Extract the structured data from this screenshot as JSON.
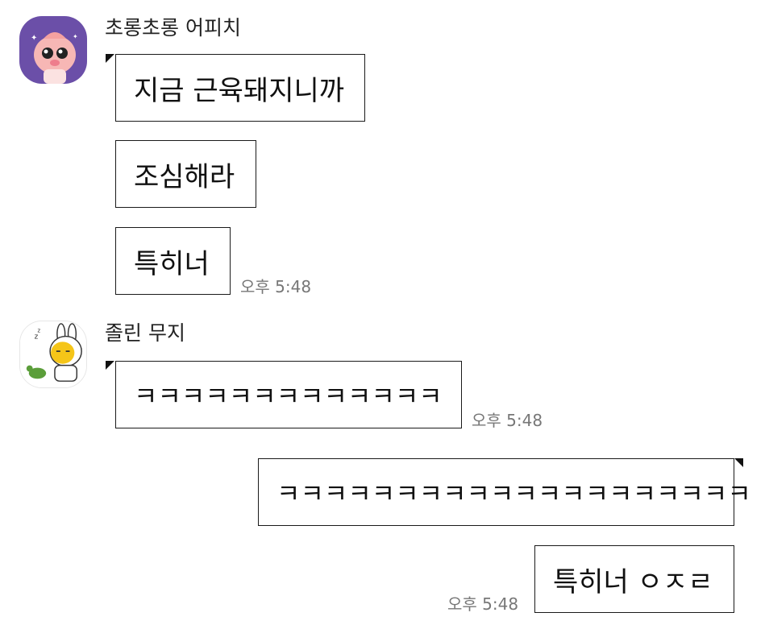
{
  "participants": {
    "apeach": {
      "name": "초롱초롱 어피치",
      "avatar_icon": "apeach-avatar-icon"
    },
    "muzi": {
      "name": "졸린 무지",
      "avatar_icon": "muzi-avatar-icon"
    }
  },
  "messages": [
    {
      "text": "지금 근육돼지니까"
    },
    {
      "text": "조심해라"
    },
    {
      "text": "특히너",
      "time": "오후 5:48"
    },
    {
      "text": "ㅋㅋㅋㅋㅋㅋㅋㅋㅋㅋㅋㅋㅋ",
      "time": "오후 5:48"
    },
    {
      "text": "ㅋㅋㅋㅋㅋㅋㅋㅋㅋㅋㅋㅋㅋㅋㅋㅋㅋㅋㅋㅋ"
    },
    {
      "text": "특히너 ㅇㅈㄹ",
      "time": "오후 5:48"
    }
  ],
  "colors": {
    "apeach_bg": "#6b4fa8",
    "border": "#1a1a1a",
    "time_text": "#777777"
  }
}
